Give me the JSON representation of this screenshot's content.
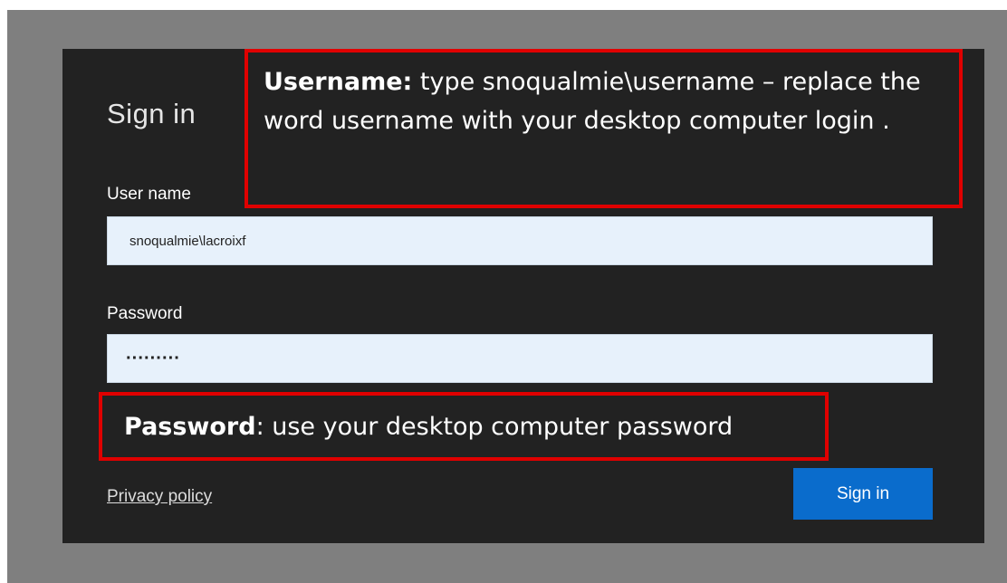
{
  "signin": {
    "title": "Sign in",
    "username_label": "User name",
    "username_value": "snoqualmie\\lacroixf",
    "password_label": "Password",
    "password_masked": "·········",
    "privacy_link": "Privacy policy",
    "submit_label": "Sign in"
  },
  "callouts": {
    "username_bold": "Username:",
    "username_text": " type snoqualmie\\username – replace the word username with your desktop computer login .",
    "password_bold": "Password",
    "password_text": ": use your desktop computer password"
  },
  "colors": {
    "frame": "#7f7f7f",
    "panel": "#222222",
    "input_bg": "#e7f1fb",
    "button": "#0a6ccc",
    "callout_border": "#e00000"
  }
}
